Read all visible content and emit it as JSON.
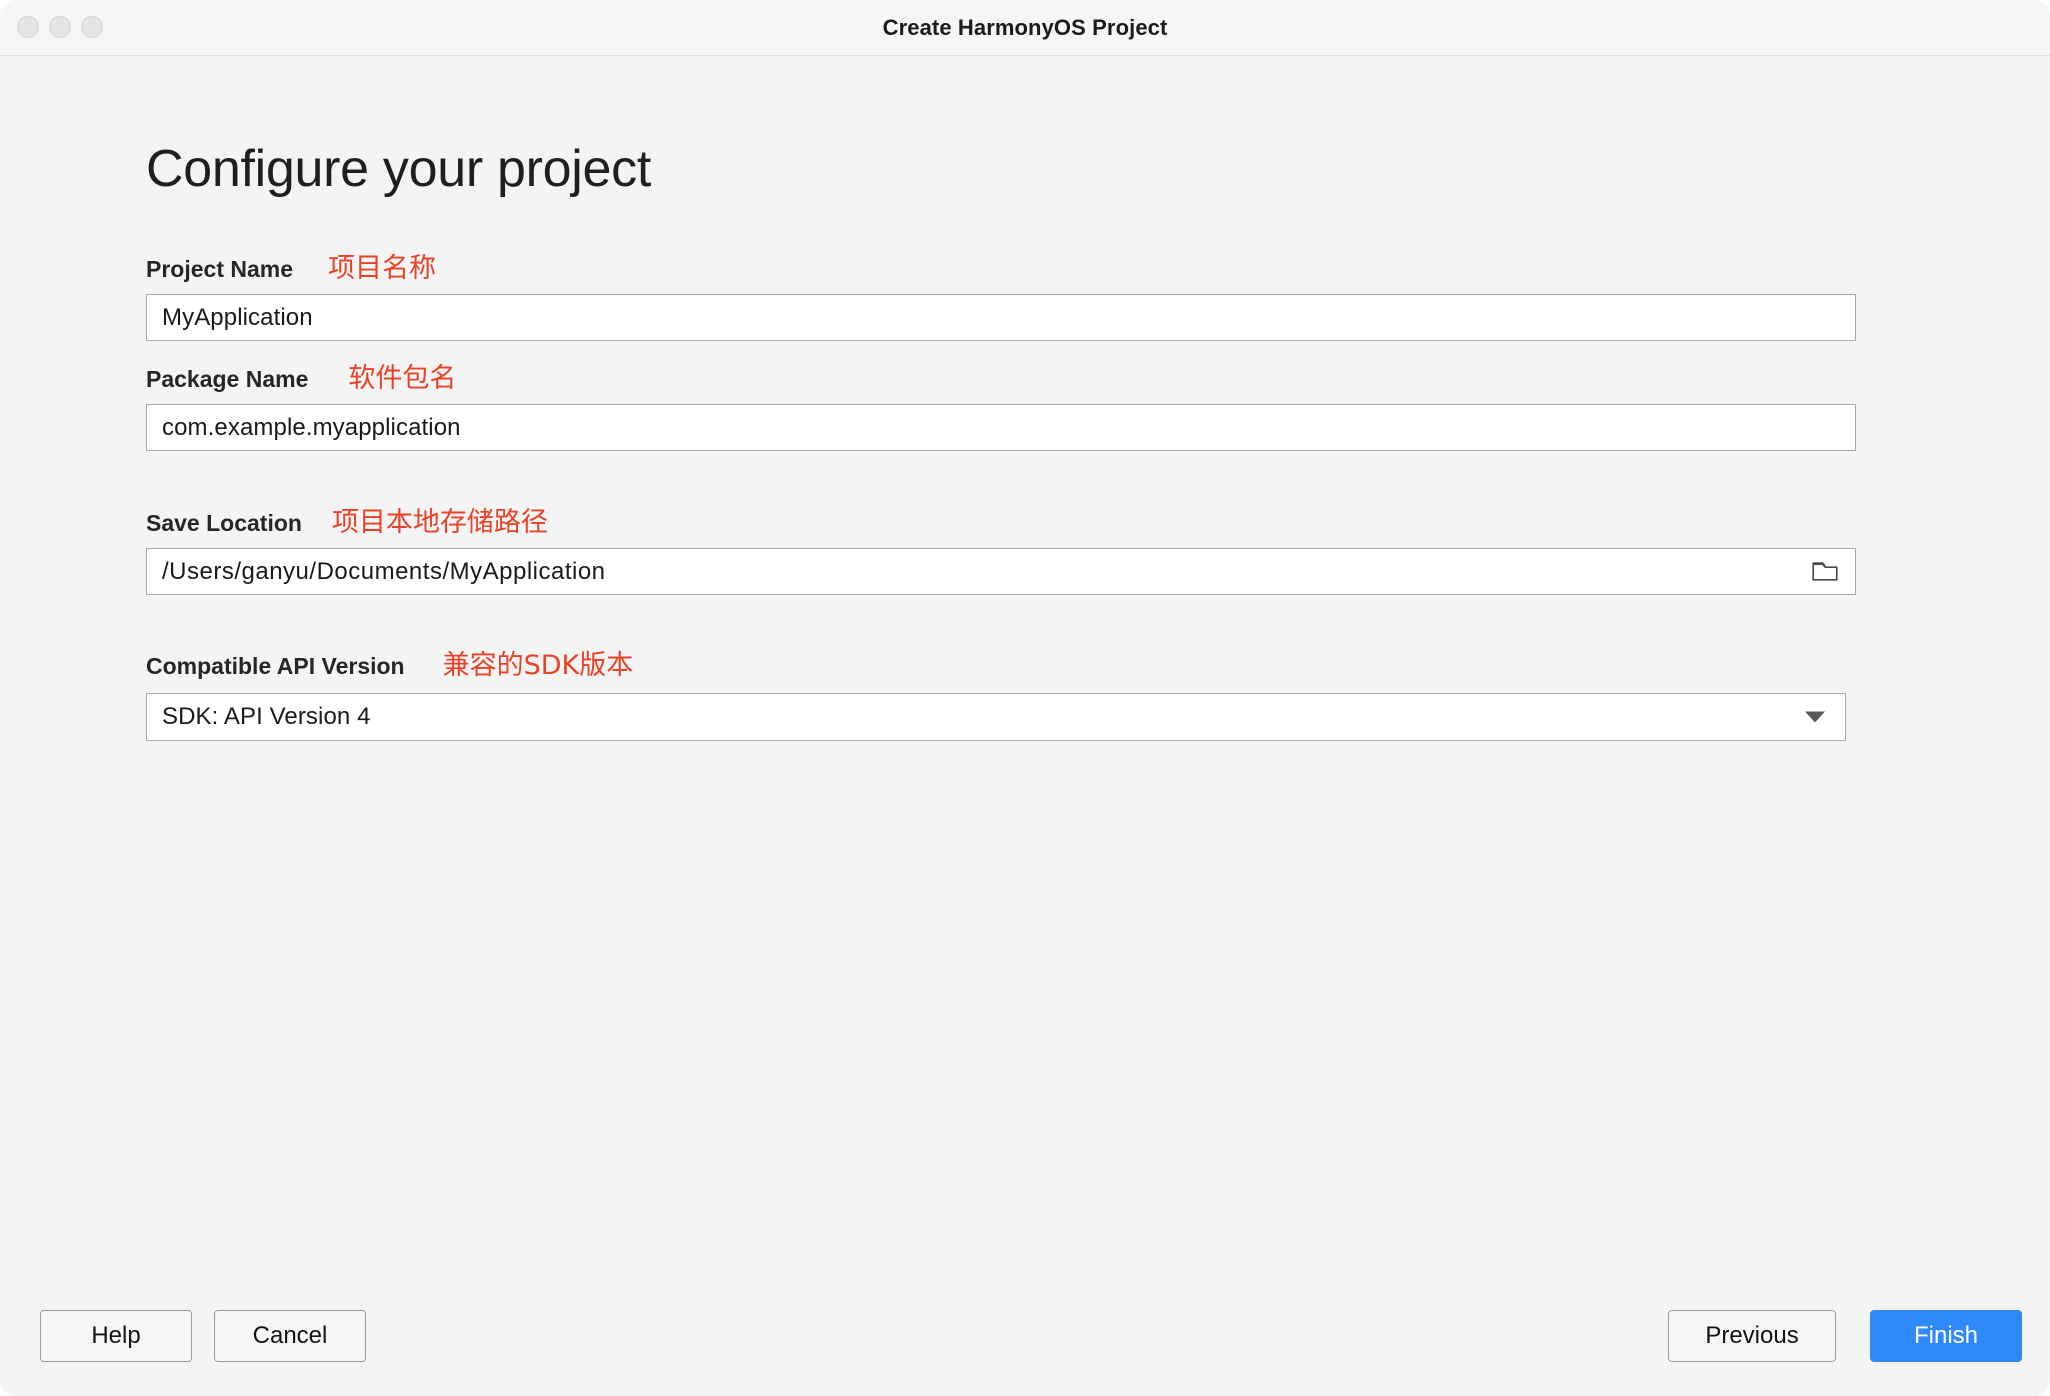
{
  "window": {
    "title": "Create HarmonyOS Project",
    "traffic_lights": [
      "close",
      "minimize",
      "maximize"
    ]
  },
  "page": {
    "heading": "Configure your project"
  },
  "form": {
    "fields": [
      {
        "label": "Project Name",
        "note": "项目名称",
        "value": "MyApplication",
        "type": "text"
      },
      {
        "label": "Package Name",
        "note": "软件包名",
        "value": "com.example.myapplication",
        "type": "text"
      },
      {
        "label": "Save Location",
        "note": "项目本地存储路径",
        "value": "/Users/ganyu/Documents/MyApplication",
        "type": "path",
        "trailing_icon": "folder-icon"
      },
      {
        "label": "Compatible API Version",
        "note": "兼容的SDK版本",
        "value": "SDK: API Version 4",
        "type": "select",
        "trailing_icon": "chevron-down-icon"
      }
    ]
  },
  "footer": {
    "help_label": "Help",
    "cancel_label": "Cancel",
    "previous_label": "Previous",
    "finish_label": "Finish"
  },
  "colors": {
    "accent": "#3089fb",
    "annotation": "#ea4226",
    "window_bg": "#f4f4f4",
    "field_border": "#a9a9a9"
  }
}
